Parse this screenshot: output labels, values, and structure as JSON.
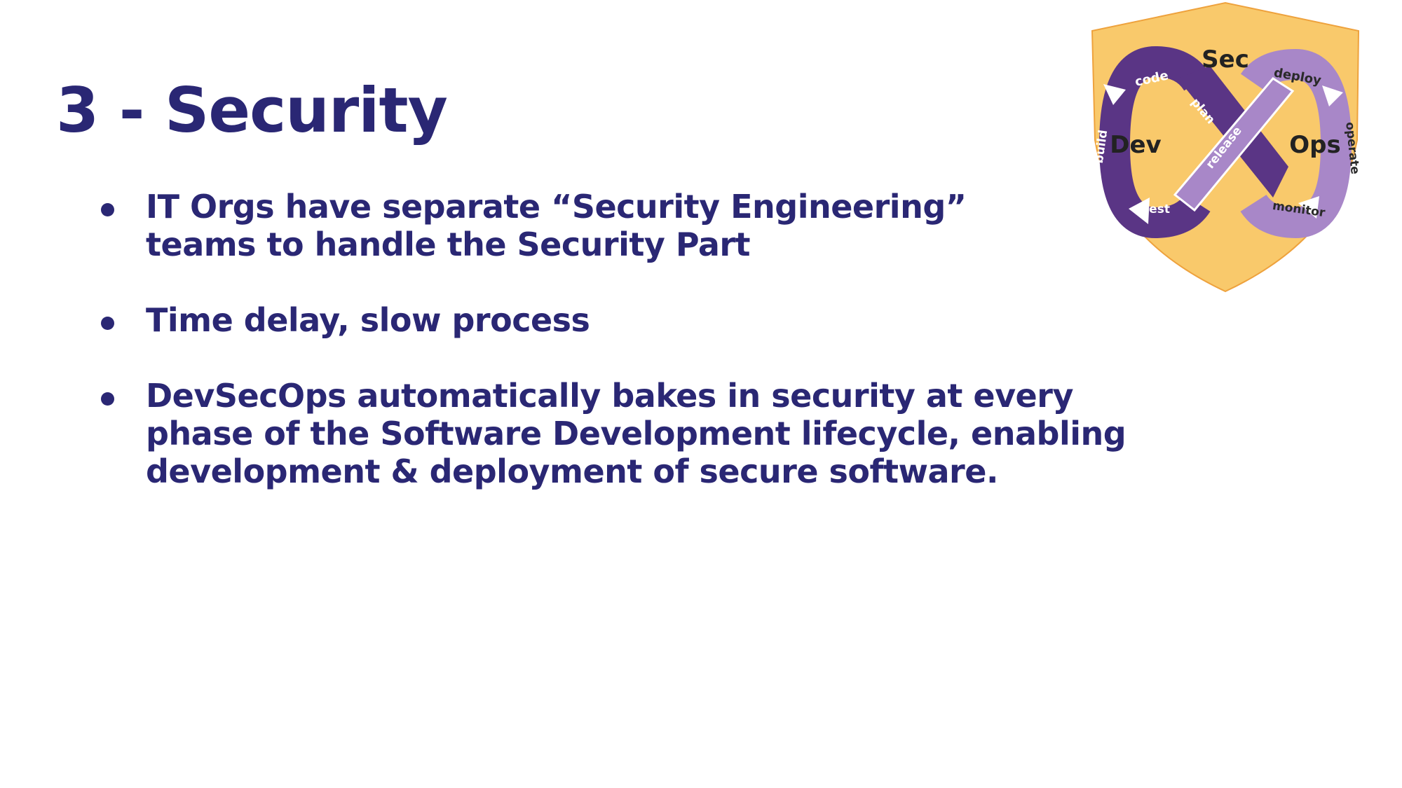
{
  "slide": {
    "title": "3 - Security",
    "bullets": [
      {
        "lines": [
          "IT Orgs have separate “Security Engineering”",
          "teams to handle the Security Part"
        ]
      },
      {
        "lines": [
          "Time delay, slow process"
        ]
      },
      {
        "lines": [
          "DevSecOps automatically bakes in security at every",
          "phase of the Software Development lifecycle, enabling",
          "development & deployment of secure software."
        ]
      }
    ]
  },
  "logo": {
    "sec": "Sec",
    "dev": "Dev",
    "ops": "Ops",
    "stages": {
      "code": "code",
      "plan": "plan",
      "build": "build",
      "test": "test",
      "release": "release",
      "deploy": "deploy",
      "operate": "operate",
      "monitor": "monitor"
    }
  },
  "colors": {
    "text": "#2a2774",
    "shield": "#f9c96b",
    "dark_purple": "#5a3585",
    "light_purple": "#a887c8"
  }
}
